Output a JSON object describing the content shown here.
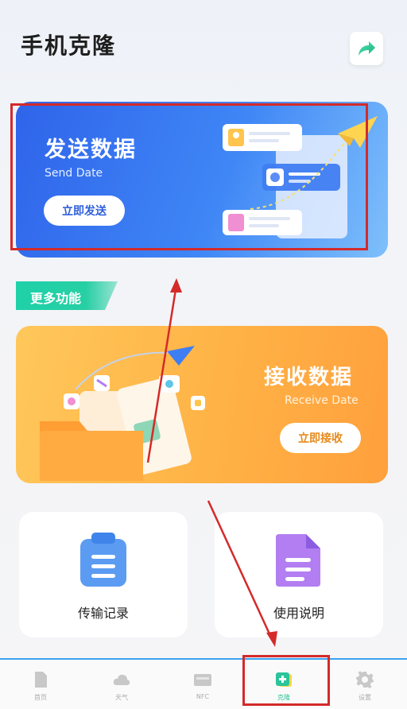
{
  "header": {
    "title": "手机克隆",
    "share_icon": "share-arrow-icon"
  },
  "send_card": {
    "title": "发送数据",
    "subtitle": "Send Date",
    "button": "立即发送",
    "colors": {
      "start": "#2f64ea",
      "end": "#7fc0fb"
    }
  },
  "more_section": {
    "label": "更多功能",
    "color": "#1fd1a9"
  },
  "receive_card": {
    "title": "接收数据",
    "subtitle": "Receive Date",
    "button": "立即接收",
    "colors": {
      "start": "#ffc75b",
      "end": "#ffa03d"
    }
  },
  "tiles": [
    {
      "label": "传输记录",
      "icon": "clipboard-list-icon",
      "color": "#5b9cf2"
    },
    {
      "label": "使用说明",
      "icon": "document-icon",
      "color": "#b27ef2"
    }
  ],
  "tab_bar": {
    "active_index": 3,
    "tabs": [
      {
        "label": "首页",
        "icon": "file-icon"
      },
      {
        "label": "天气",
        "icon": "cloud-icon"
      },
      {
        "label": "NFC",
        "icon": "card-icon"
      },
      {
        "label": "克隆",
        "icon": "clone-plus-icon"
      },
      {
        "label": "设置",
        "icon": "gear-icon"
      }
    ]
  },
  "annotations": {
    "highlight_color": "#d42a2a"
  }
}
